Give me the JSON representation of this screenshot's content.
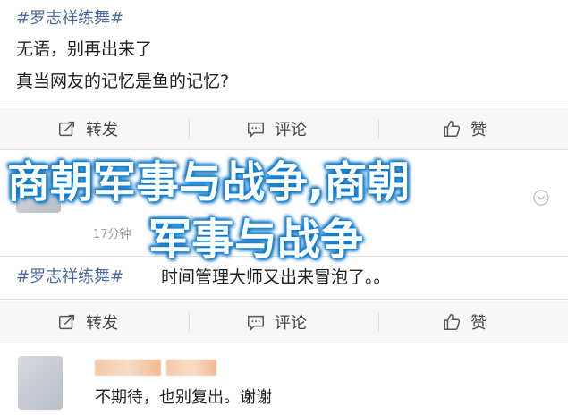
{
  "post1": {
    "hashtag": "#罗志祥练舞#",
    "line1": "无语，别再出来了",
    "line2": "真当网友的记忆是鱼的记忆?"
  },
  "actions": {
    "forward": "转发",
    "comment": "评论",
    "like": "赞"
  },
  "comment_meta": {
    "time": "17分钟"
  },
  "post2": {
    "hashtag": "#罗志祥练舞#",
    "text": "时间管理大师又出来冒泡了。。"
  },
  "post3": {
    "text": "不期待，也别复出。谢谢"
  },
  "overlay": {
    "line1": "商朝军事与战争,商朝",
    "line2": "军事与战争"
  }
}
